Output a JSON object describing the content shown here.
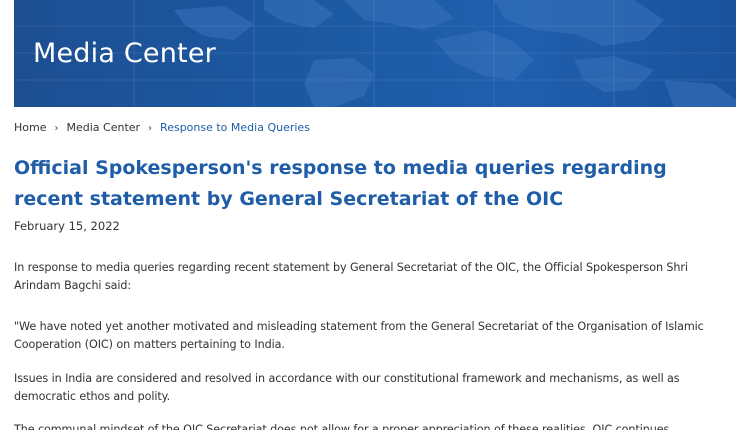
{
  "banner": {
    "title": "Media Center"
  },
  "breadcrumb": {
    "home": "Home",
    "separator": "›",
    "media_center": "Media Center",
    "current": "Response to Media Queries"
  },
  "article": {
    "title": "Official Spokesperson's response to media queries regarding recent statement by General Secretariat of the OIC",
    "date": "February 15, 2022",
    "paragraphs": [
      "In response to media queries regarding recent statement by General Secretariat of the OIC, the Official Spokesperson Shri Arindam Bagchi said:",
      "\"We have noted yet another motivated and misleading statement from the General Secretariat of the Organisation of Islamic Cooperation (OIC) on matters pertaining to India.",
      "Issues in India are considered and resolved in accordance with our constitutional framework and mechanisms, as well as democratic ethos and polity.",
      "The communal mindset of the OIC Secretariat does not allow for a proper appreciation of these realities. OIC continues"
    ]
  },
  "colors": {
    "banner": "#1c5aa3",
    "link": "#1f5da8",
    "text": "#333333"
  }
}
